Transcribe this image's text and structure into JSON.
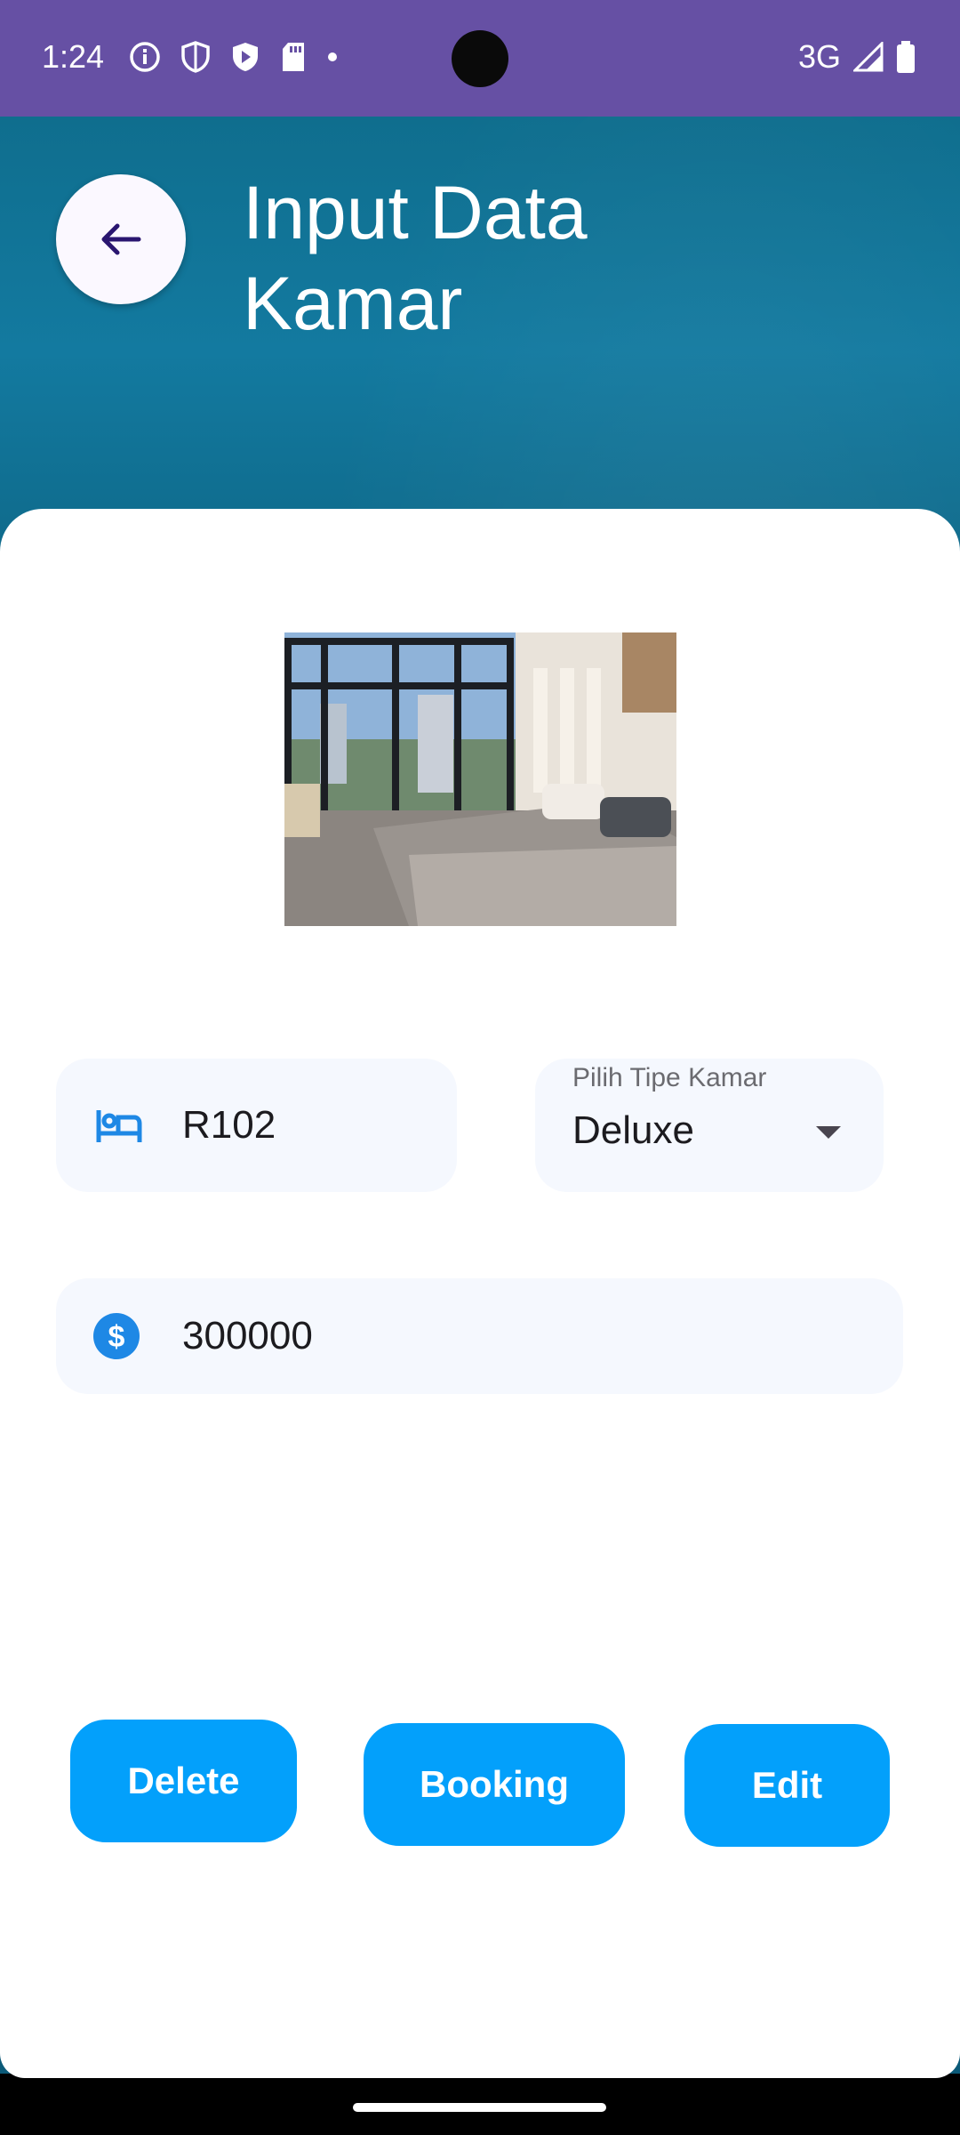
{
  "status_bar": {
    "time": "1:24",
    "network": "3G",
    "background": "#6650a4",
    "icons": [
      "info-icon",
      "shield-icon",
      "play-protect-icon",
      "sd-card-icon",
      "dot-icon",
      "signal-icon",
      "battery-icon"
    ]
  },
  "header": {
    "title": "Input Data Kamar",
    "back_icon": "arrow-left-icon"
  },
  "form": {
    "room_number": {
      "value": "R102",
      "icon": "bed-icon"
    },
    "room_type": {
      "label": "Pilih Tipe Kamar",
      "selected": "Deluxe",
      "icon": "dropdown-arrow-icon"
    },
    "price": {
      "value": "300000",
      "icon": "dollar-circle-icon"
    }
  },
  "actions": {
    "delete_label": "Delete",
    "booking_label": "Booking",
    "edit_label": "Edit",
    "accent_color": "#03a0fb"
  }
}
